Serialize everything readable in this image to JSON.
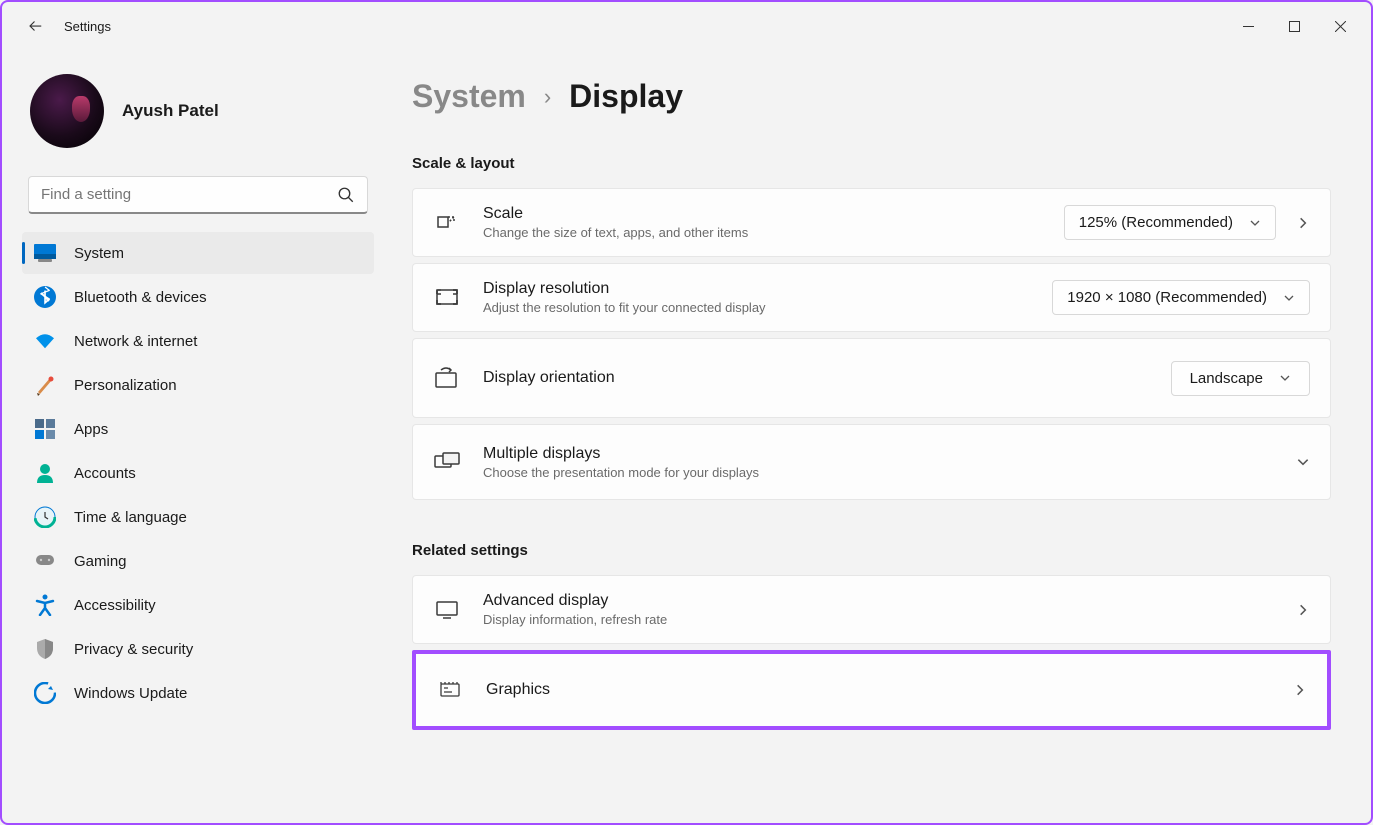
{
  "app": {
    "title": "Settings"
  },
  "profile": {
    "name": "Ayush Patel"
  },
  "search": {
    "placeholder": "Find a setting"
  },
  "nav": {
    "items": [
      {
        "label": "System"
      },
      {
        "label": "Bluetooth & devices"
      },
      {
        "label": "Network & internet"
      },
      {
        "label": "Personalization"
      },
      {
        "label": "Apps"
      },
      {
        "label": "Accounts"
      },
      {
        "label": "Time & language"
      },
      {
        "label": "Gaming"
      },
      {
        "label": "Accessibility"
      },
      {
        "label": "Privacy & security"
      },
      {
        "label": "Windows Update"
      }
    ]
  },
  "breadcrumb": {
    "parent": "System",
    "current": "Display"
  },
  "sections": {
    "scale_layout": {
      "title": "Scale & layout",
      "scale": {
        "title": "Scale",
        "sub": "Change the size of text, apps, and other items",
        "value": "125% (Recommended)"
      },
      "resolution": {
        "title": "Display resolution",
        "sub": "Adjust the resolution to fit your connected display",
        "value": "1920 × 1080 (Recommended)"
      },
      "orientation": {
        "title": "Display orientation",
        "value": "Landscape"
      },
      "multiple": {
        "title": "Multiple displays",
        "sub": "Choose the presentation mode for your displays"
      }
    },
    "related": {
      "title": "Related settings",
      "advanced": {
        "title": "Advanced display",
        "sub": "Display information, refresh rate"
      },
      "graphics": {
        "title": "Graphics"
      }
    }
  }
}
